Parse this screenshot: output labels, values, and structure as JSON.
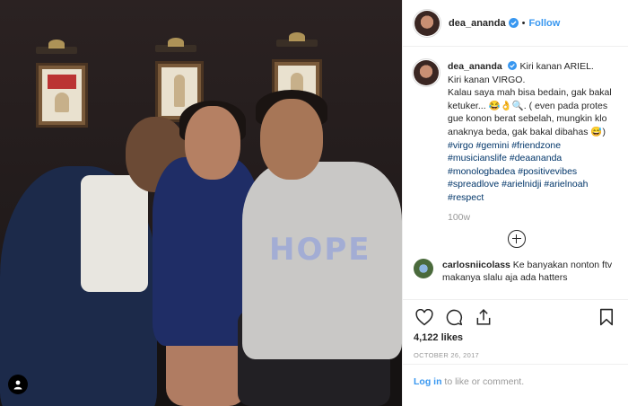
{
  "post": {
    "username": "dea_ananda",
    "follow_label": "Follow",
    "separator": "•",
    "caption_lines": [
      "Kiri kanan ARIEL.",
      "Kiri kanan VIRGO.",
      "Kalau saya mah bisa bedain, gak bakal ketuker... 😂👌🔍. ( even pada protes gue konon berat sebelah, mungkin klo anaknya beda, gak bakal dibahas 😅)"
    ],
    "hashtags": "#virgo #gemini #friendzone #musicianslife #deaananda #monologbadea #positivevibes #spreadlove #arielnidji #arielnoah #respect",
    "age": "100w",
    "photo_shirt_text": "HOPE",
    "comments": [
      {
        "username": "carlosniicolass",
        "text": "Ke banyakan nonton ftv makanya slalu aja ada hatters"
      }
    ],
    "likes": "4,122 likes",
    "date": "October 26, 2017",
    "login_link": "Log in",
    "login_suffix": " to like or comment."
  },
  "colors": {
    "accent": "#3897f0",
    "verified": "#3897f0",
    "hashtag": "#003569",
    "muted": "#999999"
  },
  "icons": [
    "verified-badge-icon",
    "heart-icon",
    "comment-icon",
    "share-icon",
    "bookmark-icon",
    "add-circle-icon",
    "user-tag-icon"
  ]
}
